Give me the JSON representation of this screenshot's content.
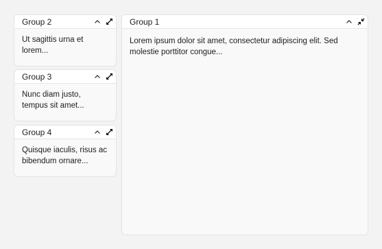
{
  "groups": [
    {
      "title": "Group 1",
      "body": "Lorem ipsum dolor sit amet, consectetur adipiscing elit. Sed molestie porttitor congue...",
      "expanded": true
    },
    {
      "title": "Group 2",
      "body": "Ut sagittis urna et lorem..."
    },
    {
      "title": "Group 3",
      "body": "Nunc diam justo, tempus sit amet..."
    },
    {
      "title": "Group 4",
      "body": "Quisque iaculis, risus ac bibendum ornare..."
    }
  ],
  "icons": {
    "collapse": "chevron-up-icon",
    "expand": "expand-arrows-icon",
    "restore": "collapse-arrows-icon"
  }
}
